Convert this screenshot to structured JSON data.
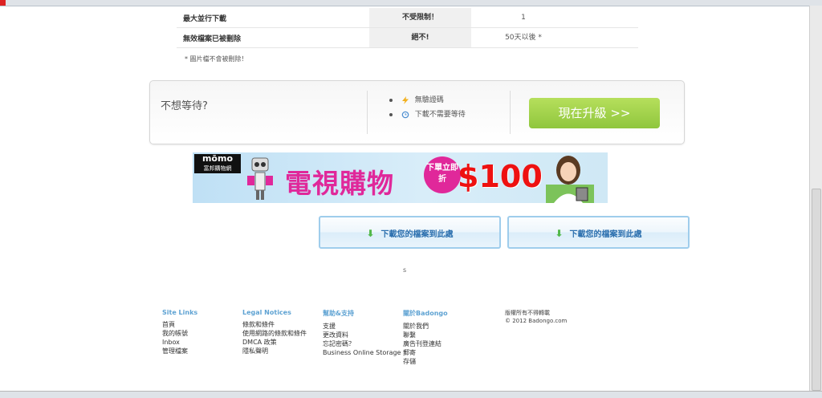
{
  "comparison": {
    "rows": [
      {
        "feature": "最大並行下載",
        "premium": "不受限制！",
        "free": "1"
      },
      {
        "feature": "無效檔案已被刪除",
        "premium": "絕不!",
        "free": "50天以後 *"
      }
    ],
    "note": "* 圖片檔不會被刪除！"
  },
  "upgrade": {
    "question": "不想等待?",
    "benefits": [
      "無驗證碼",
      "下載不需要等待"
    ],
    "button": "現在升級 >>"
  },
  "banner": {
    "logo": "mōmo",
    "logo_sub": "富邦購物網",
    "title": "電視購物",
    "badge": "下單立即折",
    "price": "$100"
  },
  "download": {
    "button1": "下載您的檔案到此處",
    "button2": "下載您的檔案到此處",
    "small_text": "s"
  },
  "footer": {
    "columns": [
      {
        "heading": "Site Links",
        "links": [
          "首頁",
          "我的帳號",
          "Inbox",
          "管理檔案"
        ]
      },
      {
        "heading": "Legal Notices",
        "links": [
          "條款和條件",
          "使用網路的條款和條件",
          "DMCA 政策",
          "隱私聲明"
        ]
      },
      {
        "heading": "幫助&支持",
        "links": [
          "支援",
          "更改資料",
          "忘記密碼？",
          "Business Online Storage"
        ]
      },
      {
        "heading": "關於Badongo",
        "links": [
          "關於我們",
          "聯繫",
          "廣告刊登連結",
          "郵寄",
          "存儲"
        ]
      }
    ],
    "copyright_lines": [
      "版權所有不得轉載",
      "© 2012 Badongo.com"
    ]
  },
  "colors": {
    "upgrade_button": "#8fc63d",
    "download_text": "#2b6fae",
    "footer_heading": "#5fa3d3",
    "banner_accent": "#e0289a"
  }
}
